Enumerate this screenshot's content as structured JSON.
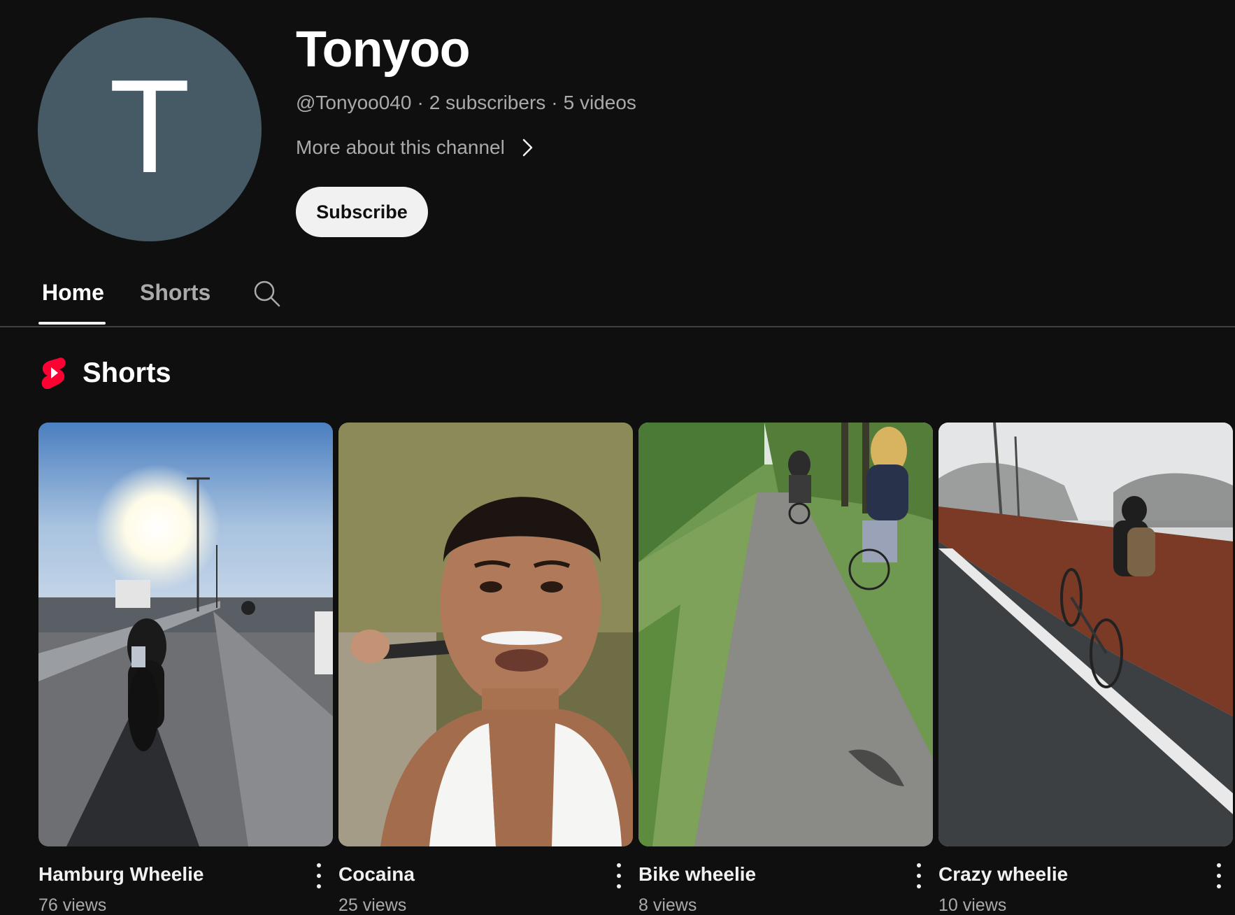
{
  "channel": {
    "avatar_letter": "T",
    "avatar_color": "#455a64",
    "name": "Tonyoo",
    "handle": "@Tonyoo040",
    "subscribers": "2 subscribers",
    "videos": "5 videos",
    "separator": "·",
    "more_about": "More about this channel",
    "subscribe_label": "Subscribe"
  },
  "tabs": {
    "home": "Home",
    "shorts": "Shorts",
    "search_icon": "search-icon"
  },
  "shorts_section": {
    "title": "Shorts",
    "icon": "youtube-shorts-icon",
    "items": [
      {
        "title": "Hamburg Wheelie",
        "views": "76 views"
      },
      {
        "title": "Cocaina",
        "views": "25 views"
      },
      {
        "title": "Bike wheelie",
        "views": "8 views"
      },
      {
        "title": "Crazy wheelie",
        "views": "10 views"
      }
    ]
  },
  "colors": {
    "background": "#0f0f0f",
    "shorts_red": "#ff0033"
  }
}
